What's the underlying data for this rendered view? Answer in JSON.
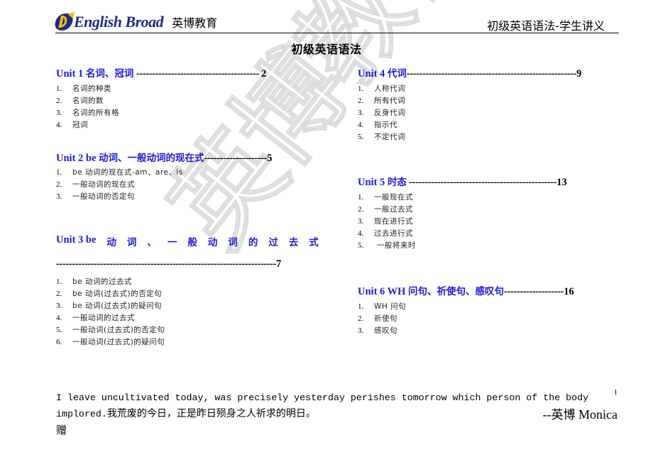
{
  "header": {
    "logo_text": "English Broad",
    "logo_cn": "英博教育",
    "doc_series_title": "初级英语语法-学生讲义"
  },
  "watermark": {
    "text": "英博教育"
  },
  "document": {
    "title": "初级英语语法"
  },
  "units": [
    {
      "label": "Unit 1",
      "title": "名词、冠词",
      "leader": " ---------------------------------------  ",
      "page": "2",
      "items": [
        {
          "num": "1.",
          "text": "名词的种类"
        },
        {
          "num": "2.",
          "text": "名词的数"
        },
        {
          "num": "3.",
          "text": "名词的所有格"
        },
        {
          "num": "4.",
          "text": "冠词"
        }
      ]
    },
    {
      "label": "Unit 2 be",
      "title": "动词、一般动词的现在式",
      "leader": "--------------------",
      "page": "5",
      "items": [
        {
          "num": "1.",
          "text": "be 动词的现在式-am、are、is"
        },
        {
          "num": "2.",
          "text": "一般动词的现在式"
        },
        {
          "num": "3.",
          "text": "一般动词的否定句"
        }
      ]
    },
    {
      "label": "Unit 3 be",
      "title_chars": [
        "动",
        "词",
        "、",
        "一",
        "般",
        "动",
        "词",
        "的",
        "过",
        "去",
        "式"
      ],
      "leader": "----------------------------------------------------------------------",
      "page": "7",
      "items": [
        {
          "num": "1.",
          "text": "be 动词的过去式"
        },
        {
          "num": "2.",
          "text": "be 动词(过去式)的否定句"
        },
        {
          "num": "3.",
          "text": "be 动词(过去式)的疑问句"
        },
        {
          "num": "4.",
          "text": "一般动词的过去式"
        },
        {
          "num": "5.",
          "text": "一般动词(过去式)的否定句"
        },
        {
          "num": "6.",
          "text": "一般动词(过去式)的疑问句"
        }
      ]
    },
    {
      "label": "Unit 4",
      "title": "代词",
      "leader": "------------------------------------------------------",
      "page": "9",
      "items": [
        {
          "num": "1.",
          "text": "人称代词"
        },
        {
          "num": "2.",
          "text": "所有代词"
        },
        {
          "num": "3.",
          "text": "反身代词"
        },
        {
          "num": "4.",
          "text": "指示代"
        },
        {
          "num": "5.",
          "text": "不定代词"
        }
      ]
    },
    {
      "label": "Unit 5",
      "title": "时态",
      "leader": "  -----------------------------------------------",
      "page": "13",
      "items": [
        {
          "num": "1.",
          "text": "一般现在式"
        },
        {
          "num": "2.",
          "text": "一般过去式"
        },
        {
          "num": "3.",
          "text": "现在进行式"
        },
        {
          "num": "4.",
          "text": "过去进行式"
        },
        {
          "num": "5.",
          "text": " 一般将来时"
        }
      ]
    },
    {
      "label": "Unit 6 WH",
      "title": "问句、祈使句、感叹句",
      "leader": "-------------------",
      "page": "16",
      "items": [
        {
          "num": "1.",
          "text": "WH 问句"
        },
        {
          "num": "2.",
          "text": "祈使句"
        },
        {
          "num": "3.",
          "text": "感叹句"
        }
      ]
    }
  ],
  "footer": {
    "quote_en_line1": "I leave uncultivated today, was precisely yesterday perishes tomorrow which person of the body",
    "quote_en_line2": "implored.",
    "quote_cn": "我荒废的今日，正是昨日殒身之人祈求的明日。",
    "quote_cn_tail": "赠",
    "signature_prefix": "--",
    "signature_cn": "英博",
    "signature_name": " Monica",
    "page_number": "1"
  }
}
